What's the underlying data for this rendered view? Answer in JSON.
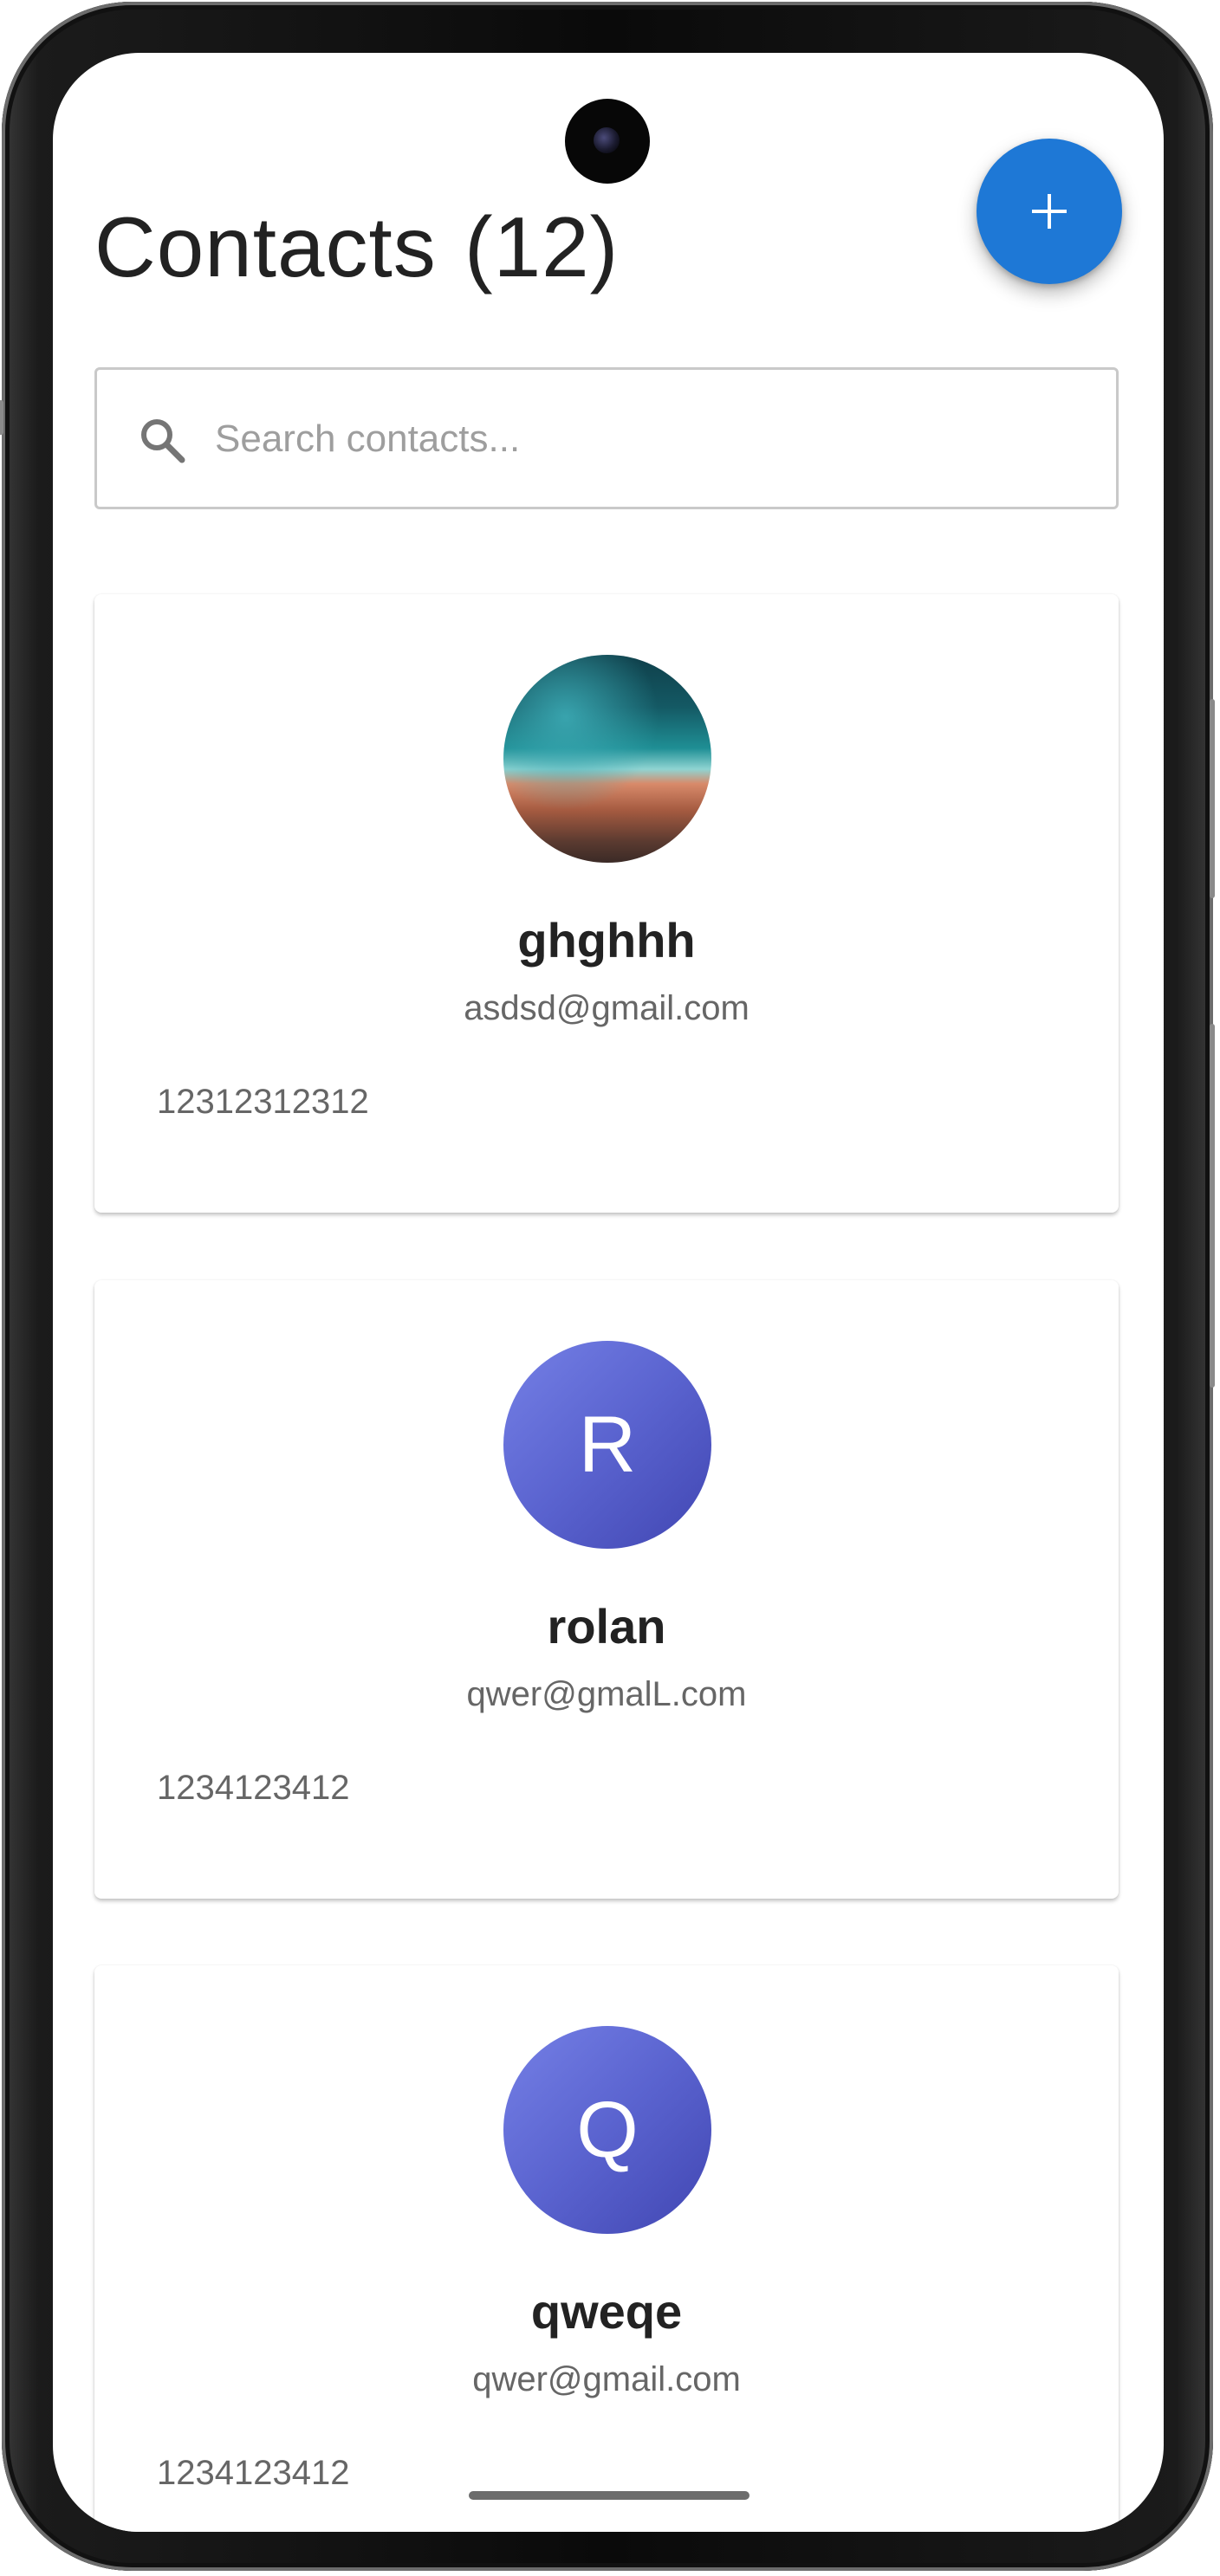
{
  "header": {
    "title": "Contacts",
    "count": "(12)",
    "add_button_icon": "plus-icon"
  },
  "search": {
    "icon": "search-icon",
    "placeholder": "Search contacts...",
    "value": ""
  },
  "contacts": [
    {
      "name": "ghghhh",
      "email": "asdsd@gmail.com",
      "phone": "12312312312",
      "avatar_type": "photo",
      "initial": ""
    },
    {
      "name": "rolan",
      "email": "qwer@gmalL.com",
      "phone": "1234123412",
      "avatar_type": "initial",
      "initial": "R"
    },
    {
      "name": "qweqe",
      "email": "qwer@gmail.com",
      "phone": "1234123412",
      "avatar_type": "initial",
      "initial": "Q"
    }
  ],
  "colors": {
    "accent": "#1e78d6",
    "avatar_gradient_start": "#7580e6",
    "avatar_gradient_end": "#4146b2",
    "title_text": "#222222",
    "secondary_text": "#666666"
  }
}
